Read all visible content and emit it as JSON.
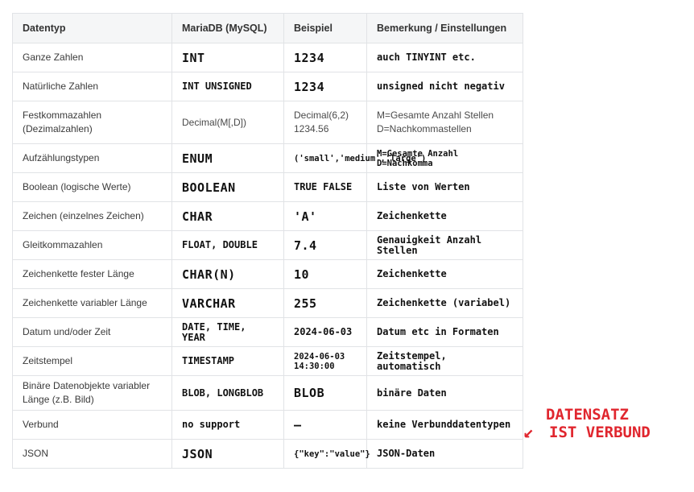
{
  "headers": [
    "Datentyp",
    "MariaDB (MySQL)",
    "Beispiel",
    "Bemerkung / Einstellungen"
  ],
  "rows": [
    {
      "type": "Ganze Zahlen",
      "db": "INT",
      "example": "1234",
      "note": "auch TINYINT etc."
    },
    {
      "type": "Natürliche Zahlen",
      "db": "INT UNSIGNED",
      "example": "1234",
      "note": "unsigned nicht negativ"
    },
    {
      "type": "Festkommazahlen (Dezimalzahlen)",
      "db": "Decimal(M[,D])",
      "example": "Decimal(6,2) 1234.56",
      "note": "M=Gesamte Anzahl Stellen D=Nachkommastellen"
    },
    {
      "type": "Aufzählungstypen",
      "db": "ENUM",
      "example": "('small','medium','large')",
      "note": "M=Gesamte Anzahl D=Nachkomma"
    },
    {
      "type": "Boolean (logische Werte)",
      "db": "BOOLEAN",
      "example": "TRUE FALSE",
      "note": "Liste von Werten"
    },
    {
      "type": "Zeichen (einzelnes Zeichen)",
      "db": "CHAR",
      "example": "'A'",
      "note": "Zeichenkette"
    },
    {
      "type": "Gleitkommazahlen",
      "db": "FLOAT, DOUBLE",
      "example": "7.4",
      "note": "Genauigkeit Anzahl Stellen"
    },
    {
      "type": "Zeichenkette fester Länge",
      "db": "CHAR(N)",
      "example": "10",
      "note": "Zeichenkette"
    },
    {
      "type": "Zeichenkette variabler Länge",
      "db": "VARCHAR",
      "example": "255",
      "note": "Zeichenkette (variabel)"
    },
    {
      "type": "Datum und/oder Zeit",
      "db": "DATE, TIME, YEAR",
      "example": "2024-06-03",
      "note": "Datum etc in Formaten"
    },
    {
      "type": "Zeitstempel",
      "db": "TIMESTAMP",
      "example": "2024-06-03 14:30:00",
      "note": "Zeitstempel, automatisch"
    },
    {
      "type": "Binäre Datenobjekte variabler Länge (z.B. Bild)",
      "db": "BLOB, LONGBLOB",
      "example": "BLOB",
      "note": "binäre Daten"
    },
    {
      "type": "Verbund",
      "db": "no support",
      "example": "—",
      "note": "keine Verbunddatentypen"
    },
    {
      "type": "JSON",
      "db": "JSON",
      "example": "{\"key\":\"value\"}",
      "note": "JSON-Daten"
    }
  ],
  "annotation": {
    "line1": "DATENSATZ",
    "line2": "IST VERBUND",
    "arrow": "↙"
  }
}
